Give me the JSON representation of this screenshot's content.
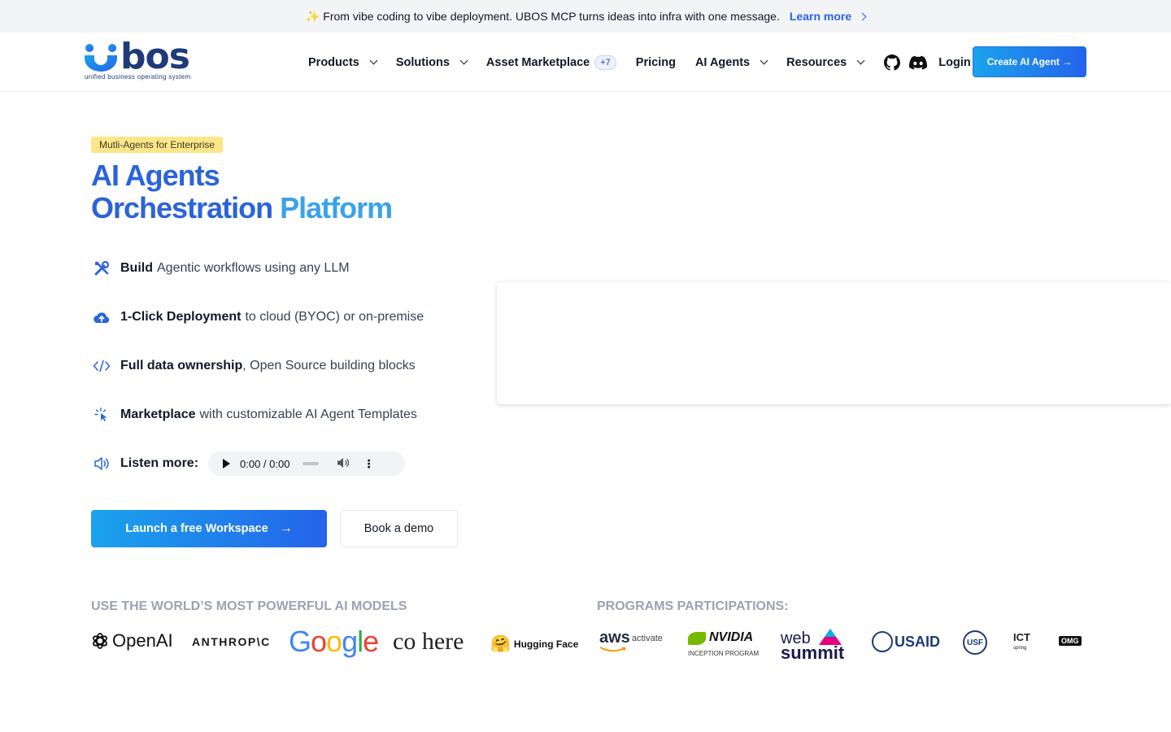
{
  "announcement": {
    "text": "From vibe coding to vibe deployment. UBOS MCP turns ideas into infra with one message.",
    "link_label": "Learn more"
  },
  "header": {
    "logo_word": "bos",
    "logo_tagline": "unified business operating system",
    "nav": [
      {
        "label": "Products",
        "has_dropdown": true
      },
      {
        "label": "Solutions",
        "has_dropdown": true
      },
      {
        "label": "Asset Marketplace",
        "badge": "+7"
      },
      {
        "label": "Pricing"
      },
      {
        "label": "AI Agents",
        "has_dropdown": true
      },
      {
        "label": "Resources",
        "has_dropdown": true
      }
    ],
    "icons": [
      "github-icon",
      "discord-icon"
    ],
    "login_label": "Login",
    "cta_label": "Create AI Agent →"
  },
  "hero": {
    "pill": "Mutli-Agents for Enterprise",
    "title_line1": "AI Agents",
    "title_line2a": "Orchestration ",
    "title_line2b": "Platform",
    "features": [
      {
        "bold": "Build",
        "rest": "Agentic workflows using any LLM",
        "icon": "tools-icon"
      },
      {
        "bold": "1-Click Deployment",
        "rest": "to cloud (BYOC) or on-premise",
        "icon": "cloud-upload-icon"
      },
      {
        "bold": "Full data ownership",
        "rest": ", Open Source building blocks",
        "icon": "code-icon"
      },
      {
        "bold": "Marketplace",
        "rest": "with customizable AI Agent Templates",
        "icon": "cursor-click-icon"
      }
    ],
    "listen_label": "Listen more:",
    "audio_time": "0:00 / 0:00",
    "primary_button": "Launch a free Workspace",
    "secondary_button": "Book a demo"
  },
  "models_section": {
    "title": "USE THE WORLD’S MOST POWERFUL AI MODELS",
    "logos": [
      "OpenAI",
      "ANTHROP\\C",
      "Google",
      "co here",
      "Hugging Face"
    ]
  },
  "programs_section": {
    "title": "PROGRAMS PARTICIPATIONS:",
    "logos": [
      "aws",
      "activate",
      "NVIDIA",
      "INCEPTION PROGRAM",
      "web",
      "summit",
      "USAID",
      "USF",
      "ICT",
      "spring",
      "OMG"
    ]
  },
  "colors": {
    "brand_blue": "#2b63d9",
    "brand_light_blue": "#3aa2ea",
    "pill_bg": "#fde68a",
    "link": "#2563eb"
  }
}
